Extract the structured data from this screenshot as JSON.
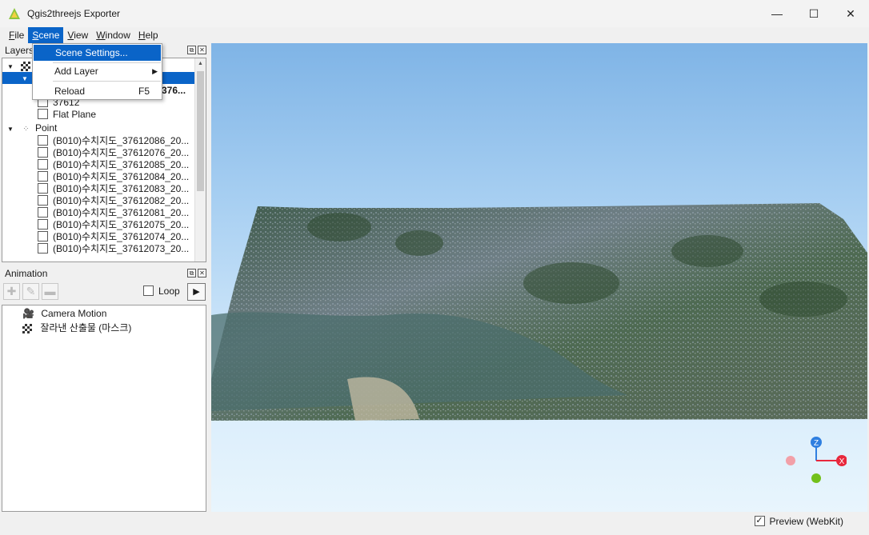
{
  "window": {
    "title": "Qgis2threejs Exporter",
    "controls": {
      "minimize": "—",
      "maximize": "☐",
      "close": "✕"
    }
  },
  "menubar": {
    "items": [
      {
        "label": "File",
        "mnemonic": "F",
        "rest": "ile"
      },
      {
        "label": "Scene",
        "mnemonic": "S",
        "rest": "cene"
      },
      {
        "label": "View",
        "mnemonic": "V",
        "rest": "iew"
      },
      {
        "label": "Window",
        "mnemonic": "W",
        "rest": "indow"
      },
      {
        "label": "Help",
        "mnemonic": "H",
        "rest": "elp"
      }
    ]
  },
  "scene_menu": {
    "items": [
      {
        "label": "Scene Settings..."
      },
      {
        "label": "Add Layer"
      },
      {
        "label": "Reload",
        "shortcut": "F5"
      }
    ]
  },
  "layers_panel": {
    "title": "Layers",
    "truncated_row": "376...",
    "rows": [
      {
        "label": "37612"
      },
      {
        "label": "Flat Plane"
      }
    ],
    "group": {
      "label": "Point"
    },
    "points": [
      "(B010)수치지도_37612086_20...",
      "(B010)수치지도_37612076_20...",
      "(B010)수치지도_37612085_20...",
      "(B010)수치지도_37612084_20...",
      "(B010)수치지도_37612083_20...",
      "(B010)수치지도_37612082_20...",
      "(B010)수치지도_37612081_20...",
      "(B010)수치지도_37612075_20...",
      "(B010)수치지도_37612074_20...",
      "(B010)수치지도_37612073_20..."
    ]
  },
  "animation_panel": {
    "title": "Animation",
    "loop_label": "Loop",
    "play_glyph": "▶",
    "items": [
      {
        "label": "Camera Motion"
      },
      {
        "label": "잘라낸 산출물 (마스크)"
      }
    ]
  },
  "viewport": {
    "axes": {
      "z": "Z",
      "x": "X"
    },
    "colors": {
      "z": "#2f7fe0",
      "x": "#e8283c",
      "y": "#72c01a",
      "neg": "#f2a0a8"
    }
  },
  "statusbar": {
    "preview_label": "Preview (WebKit)",
    "preview_checked": true
  }
}
